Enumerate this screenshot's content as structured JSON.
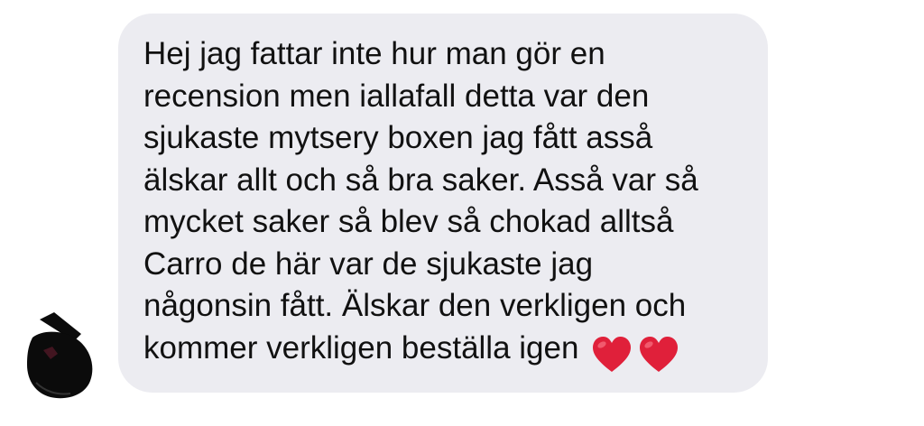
{
  "conversation": {
    "message": {
      "text": "Hej jag fattar inte hur man gör en\nrecension men iallafall detta var den\nsjukaste mytsery boxen jag fått asså\nälskar allt och så bra saker. Asså var så\nmycket saker så blev så chokad alltså\nCarro de här var de sjukaste jag\nnågonsin fått. Älskar den verkligen och\nkommer verkligen beställa igen",
      "emoji": [
        "red-heart",
        "red-heart"
      ]
    },
    "sender_avatar": {
      "icon": "avatar-icon"
    }
  },
  "colors": {
    "bubble_background": "#ececf1",
    "text": "#111111",
    "heart": "#e0203a",
    "avatar": "#0b0b0b"
  }
}
